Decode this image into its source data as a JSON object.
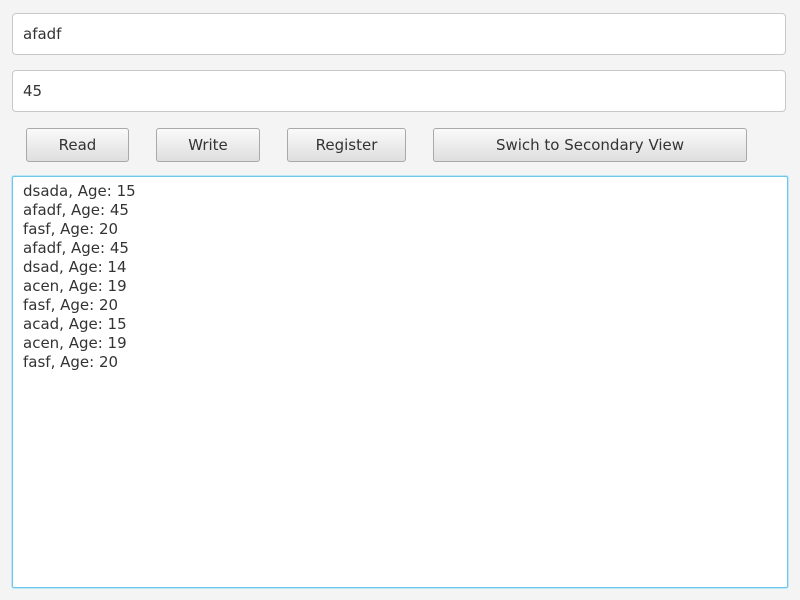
{
  "form": {
    "name_value": "afadf",
    "age_value": "45"
  },
  "buttons": {
    "read": "Read",
    "write": "Write",
    "register": "Register",
    "switch_view": "Swich to Secondary View"
  },
  "records": [
    "dsada, Age: 15",
    "afadf, Age: 45",
    "fasf, Age: 20",
    "afadf, Age: 45",
    "dsad, Age: 14",
    "acen, Age: 19",
    "fasf, Age: 20",
    "acad, Age: 15",
    "acen, Age: 19",
    "fasf, Age: 20"
  ],
  "colors": {
    "focus_border": "#6ec8e8",
    "background": "#f4f4f4"
  }
}
